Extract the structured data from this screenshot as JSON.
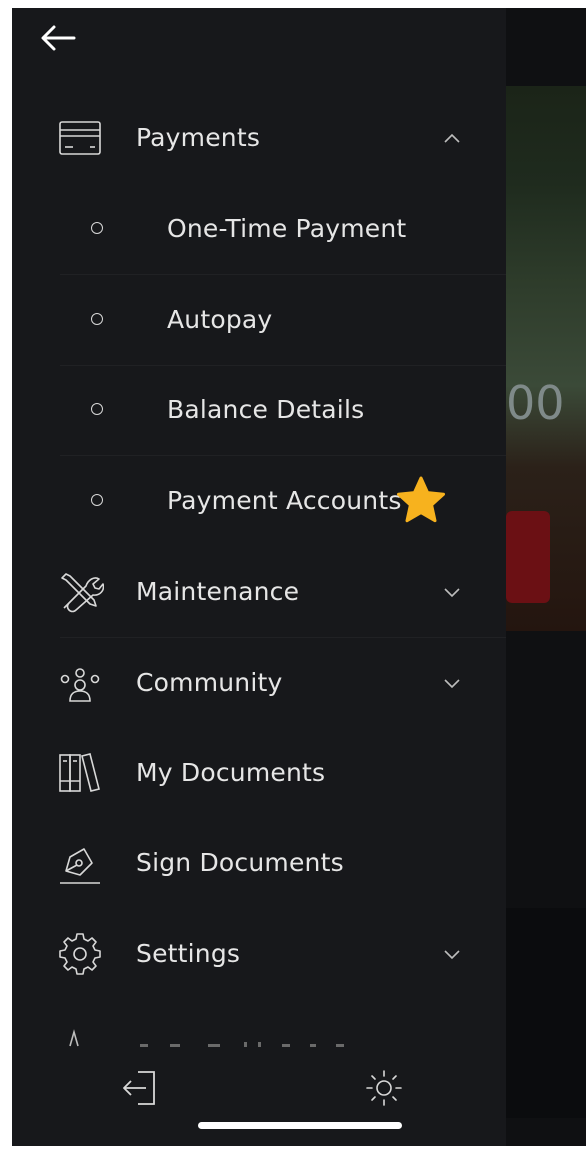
{
  "background": {
    "amount_fragment": "00"
  },
  "menu": {
    "payments": {
      "label": "Payments",
      "subitems": [
        {
          "label": "One-Time Payment"
        },
        {
          "label": "Autopay"
        },
        {
          "label": "Balance Details"
        },
        {
          "label": "Payment Accounts"
        }
      ]
    },
    "maintenance": {
      "label": "Maintenance"
    },
    "community": {
      "label": "Community"
    },
    "my_documents": {
      "label": "My Documents"
    },
    "sign_documents": {
      "label": "Sign Documents"
    },
    "settings": {
      "label": "Settings"
    }
  },
  "icons": {
    "back": "arrow-left-icon",
    "payments": "credit-card-icon",
    "maintenance": "tools-icon",
    "community": "people-icon",
    "my_documents": "binders-icon",
    "sign_documents": "pen-sign-icon",
    "settings": "gear-icon",
    "logout": "logout-icon",
    "theme": "sun-icon",
    "highlight": "star-icon"
  },
  "colors": {
    "drawer_bg": "#17181b",
    "text": "#e6e6e6",
    "star": "#f7b21e"
  }
}
